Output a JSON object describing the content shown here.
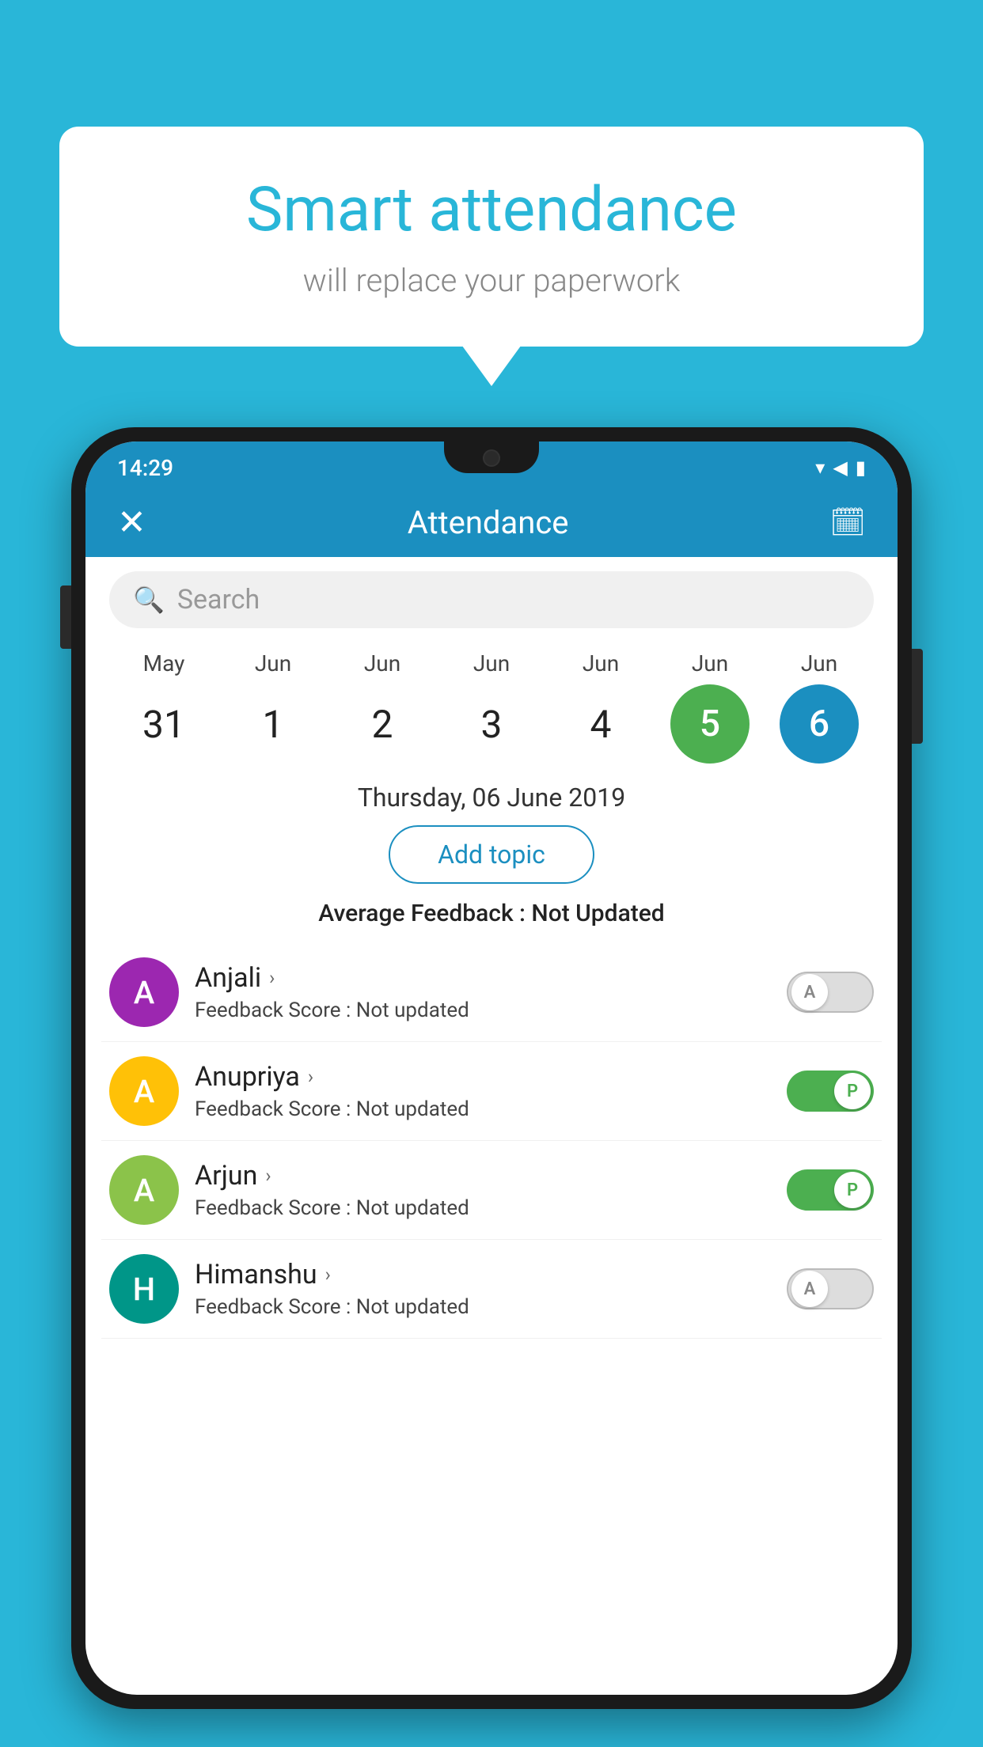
{
  "background_color": "#29b6d8",
  "speech_bubble": {
    "title": "Smart attendance",
    "subtitle": "will replace your paperwork"
  },
  "status_bar": {
    "time": "14:29",
    "wifi": "▾",
    "signal": "▲",
    "battery": "▮"
  },
  "app_header": {
    "title": "Attendance",
    "close_label": "✕",
    "calendar_icon": "📅"
  },
  "search": {
    "placeholder": "Search"
  },
  "calendar": {
    "months": [
      "May",
      "Jun",
      "Jun",
      "Jun",
      "Jun",
      "Jun",
      "Jun"
    ],
    "dates": [
      "31",
      "1",
      "2",
      "3",
      "4",
      "5",
      "6"
    ],
    "active_green": "5",
    "active_blue": "6"
  },
  "selected_date": "Thursday, 06 June 2019",
  "add_topic_label": "Add topic",
  "avg_feedback_label": "Average Feedback :",
  "avg_feedback_value": "Not Updated",
  "students": [
    {
      "name": "Anjali",
      "initial": "A",
      "color": "purple",
      "feedback_prefix": "Feedback Score :",
      "feedback_value": "Not updated",
      "toggle_state": "off",
      "toggle_label": "A"
    },
    {
      "name": "Anupriya",
      "initial": "A",
      "color": "amber",
      "feedback_prefix": "Feedback Score :",
      "feedback_value": "Not updated",
      "toggle_state": "on",
      "toggle_label": "P"
    },
    {
      "name": "Arjun",
      "initial": "A",
      "color": "lightgreen",
      "feedback_prefix": "Feedback Score :",
      "feedback_value": "Not updated",
      "toggle_state": "on",
      "toggle_label": "P"
    },
    {
      "name": "Himanshu",
      "initial": "H",
      "color": "teal",
      "feedback_prefix": "Feedback Score :",
      "feedback_value": "Not updated",
      "toggle_state": "off",
      "toggle_label": "A"
    }
  ]
}
